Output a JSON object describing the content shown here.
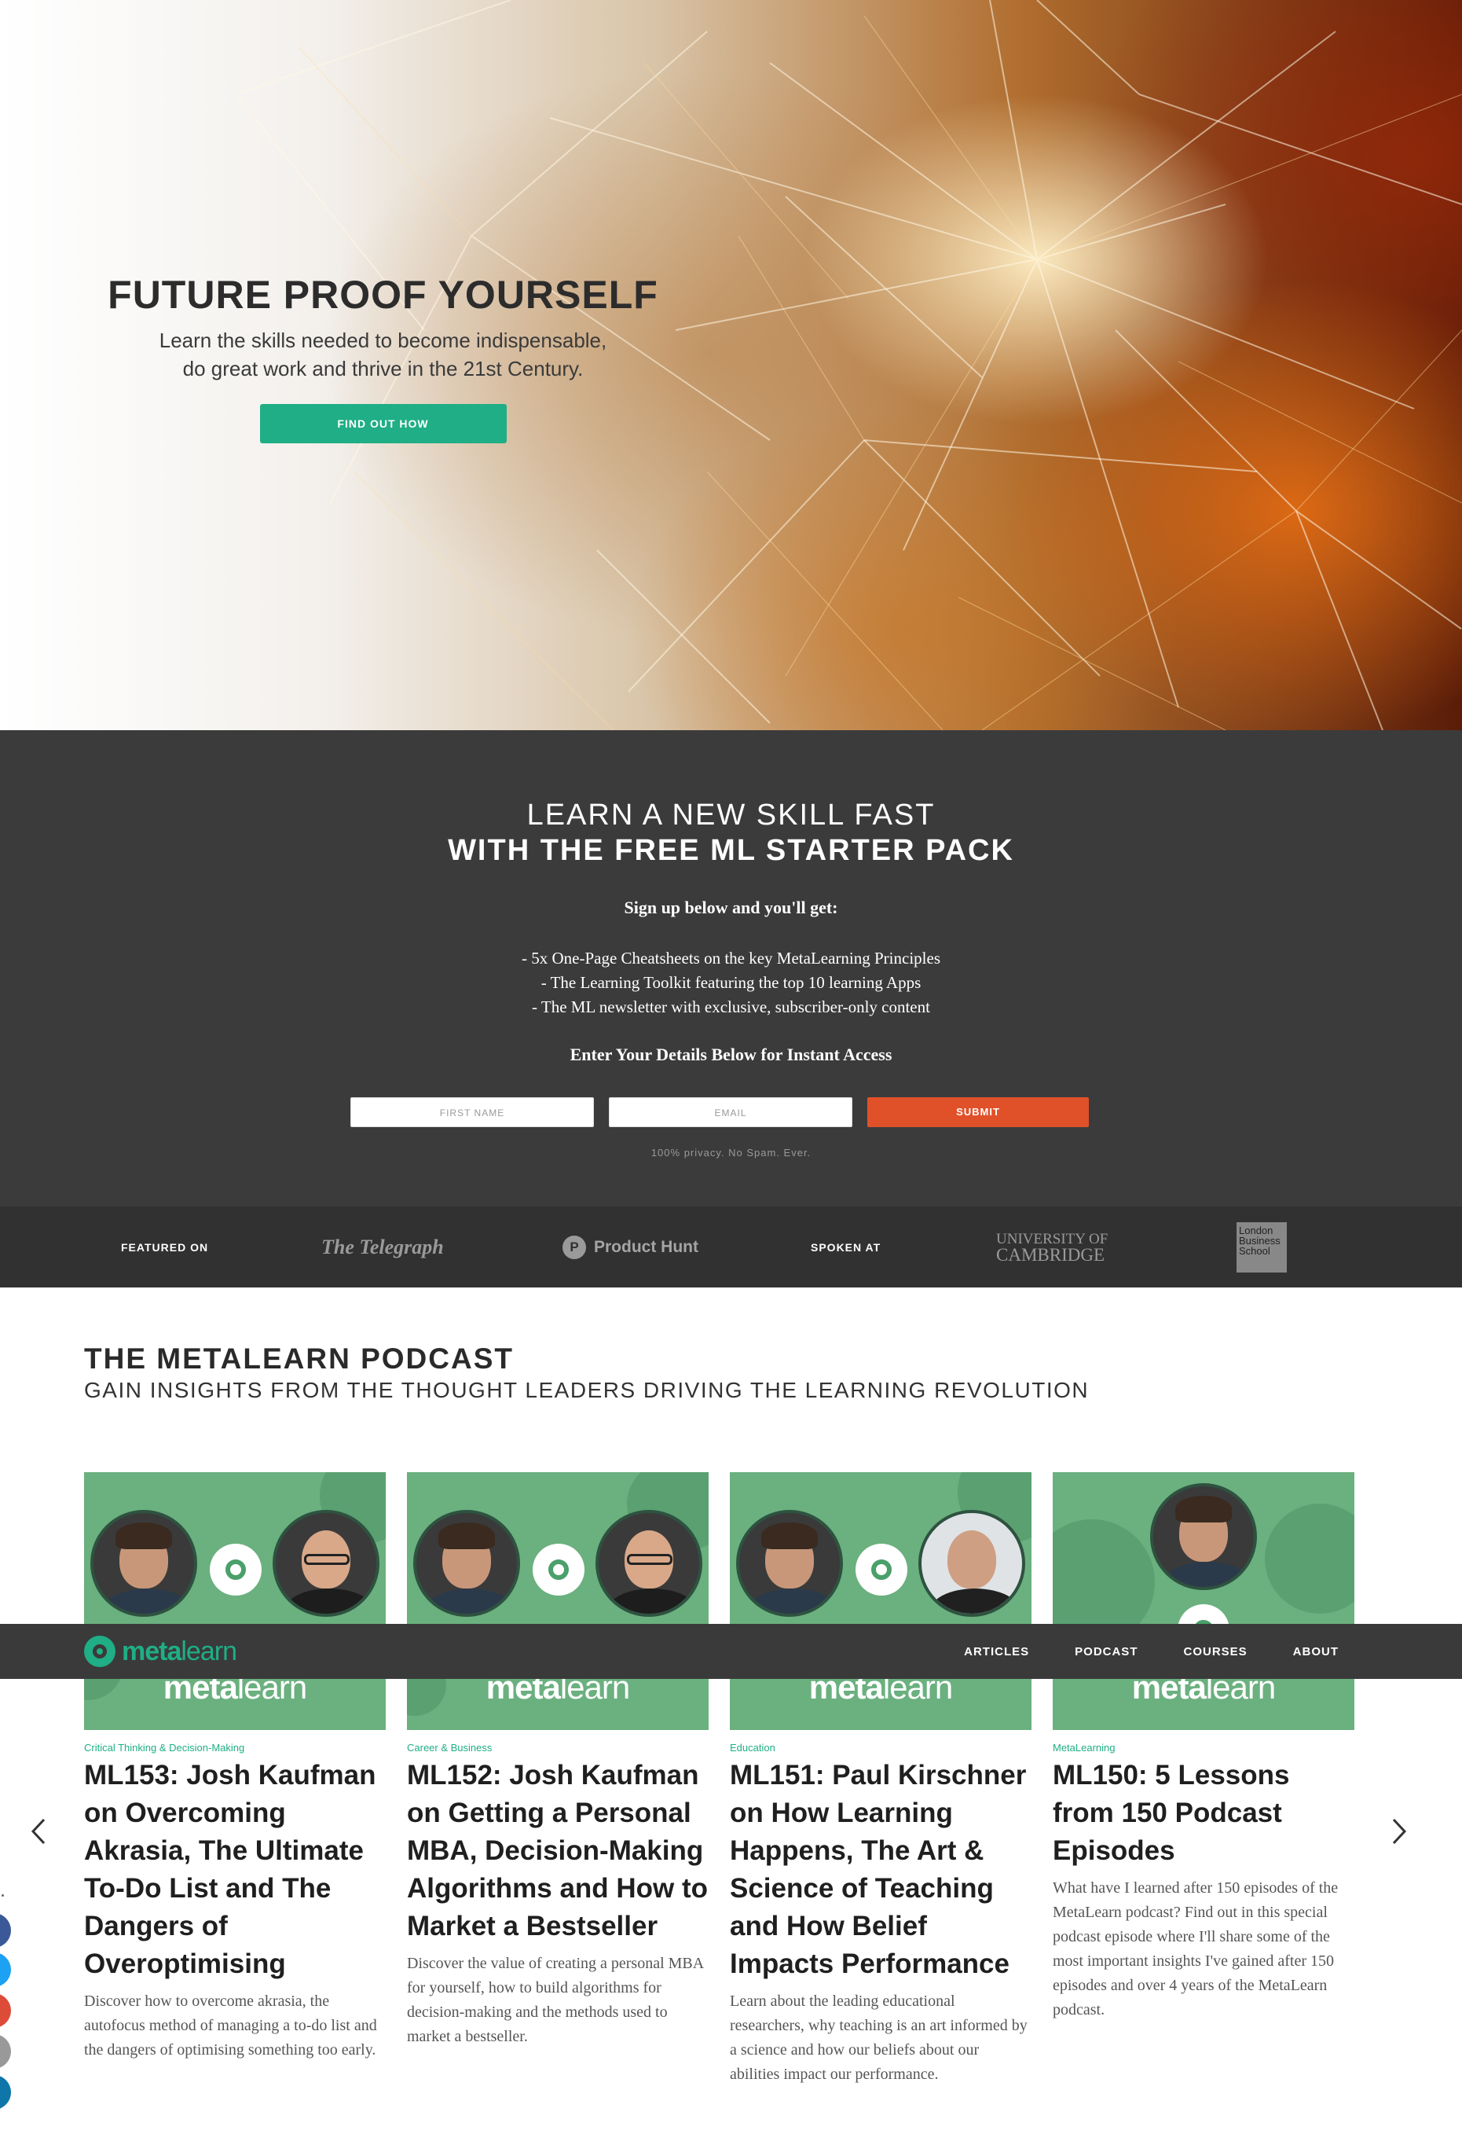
{
  "hero": {
    "title": "FUTURE PROOF YOURSELF",
    "subtitle_line1": "Learn the skills needed to become indispensable,",
    "subtitle_line2": "do great work and thrive in the 21st Century.",
    "cta_label": "FIND OUT HOW"
  },
  "starter": {
    "heading_line1": "LEARN A NEW SKILL FAST",
    "heading_line2": "WITH THE FREE ML STARTER PACK",
    "signup_intro": "Sign up below and you'll get:",
    "benefits": [
      "- 5x One-Page Cheatsheets on the key MetaLearning Principles",
      "- The Learning Toolkit featuring the top 10 learning Apps",
      "- The ML newsletter with exclusive, subscriber-only content"
    ],
    "access_text": "Enter Your Details Below for Instant Access",
    "first_name_placeholder": "FIRST NAME",
    "email_placeholder": "EMAIL",
    "submit_label": "SUBMIT",
    "privacy_note": "100% privacy. No Spam. Ever."
  },
  "featured": {
    "featured_label": "FEATURED ON",
    "telegraph": "The Telegraph",
    "product_hunt": "Product Hunt",
    "product_hunt_mark": "P",
    "spoken_label": "SPOKEN AT",
    "cambridge_line1": "UNIVERSITY OF",
    "cambridge_line2": "CAMBRIDGE",
    "lbs_line1": "London",
    "lbs_line2": "Business",
    "lbs_line3": "School"
  },
  "podcast": {
    "title": "THE METALEARN PODCAST",
    "subtitle": "GAIN INSIGHTS FROM THE THOUGHT LEADERS DRIVING THE LEARNING REVOLUTION",
    "thumb_logo_bold": "meta",
    "thumb_logo_light": "learn",
    "cards": [
      {
        "category": "Critical Thinking & Decision-Making",
        "title": "ML153: Josh Kaufman on Overcoming Akrasia, The Ultimate To-Do List and The Dangers of Overoptimising",
        "description": "Discover how to overcome akrasia, the autofocus method of managing a to-do list and the dangers of optimising something too early."
      },
      {
        "category": "Career & Business",
        "title": "ML152: Josh Kaufman on Getting a Personal MBA, Decision-Making Algorithms and How to Market a Bestseller",
        "description": "Discover the value of creating a personal MBA for yourself, how to build algorithms for decision-making and the methods used to market a bestseller."
      },
      {
        "category": "Education",
        "title": "ML151: Paul Kirschner on How Learning Happens, The Art & Science of Teaching and How Belief Impacts Performance",
        "description": "Learn about the leading educational researchers, why teaching is an art informed by a science and how our beliefs about our abilities impact our performance."
      },
      {
        "category": "MetaLearning",
        "title": "ML150: 5 Lessons from 150 Podcast Episodes",
        "description": "What have I learned after 150 episodes of the MetaLearn podcast? Find out in this special podcast episode where I'll share some of the most important insights I've gained after 150 episodes and over 4 years of the MetaLearn podcast."
      }
    ]
  },
  "nav": {
    "logo_bold": "meta",
    "logo_light": "learn",
    "links": [
      "ARTICLES",
      "PODCAST",
      "COURSES",
      "ABOUT"
    ]
  },
  "icons": {
    "prev": "chevron-left-icon",
    "next": "chevron-right-icon",
    "social": [
      "facebook-icon",
      "twitter-icon",
      "google-plus-icon",
      "email-icon",
      "linkedin-icon"
    ]
  },
  "colors": {
    "accent_green": "#1fae85",
    "submit_orange": "#e0512a",
    "dark_band": "#3b3b3b",
    "thumb_green": "#6bb07f",
    "social": [
      "#3b5998",
      "#1da1f2",
      "#dd4b39",
      "#999999",
      "#0e76a8"
    ]
  }
}
